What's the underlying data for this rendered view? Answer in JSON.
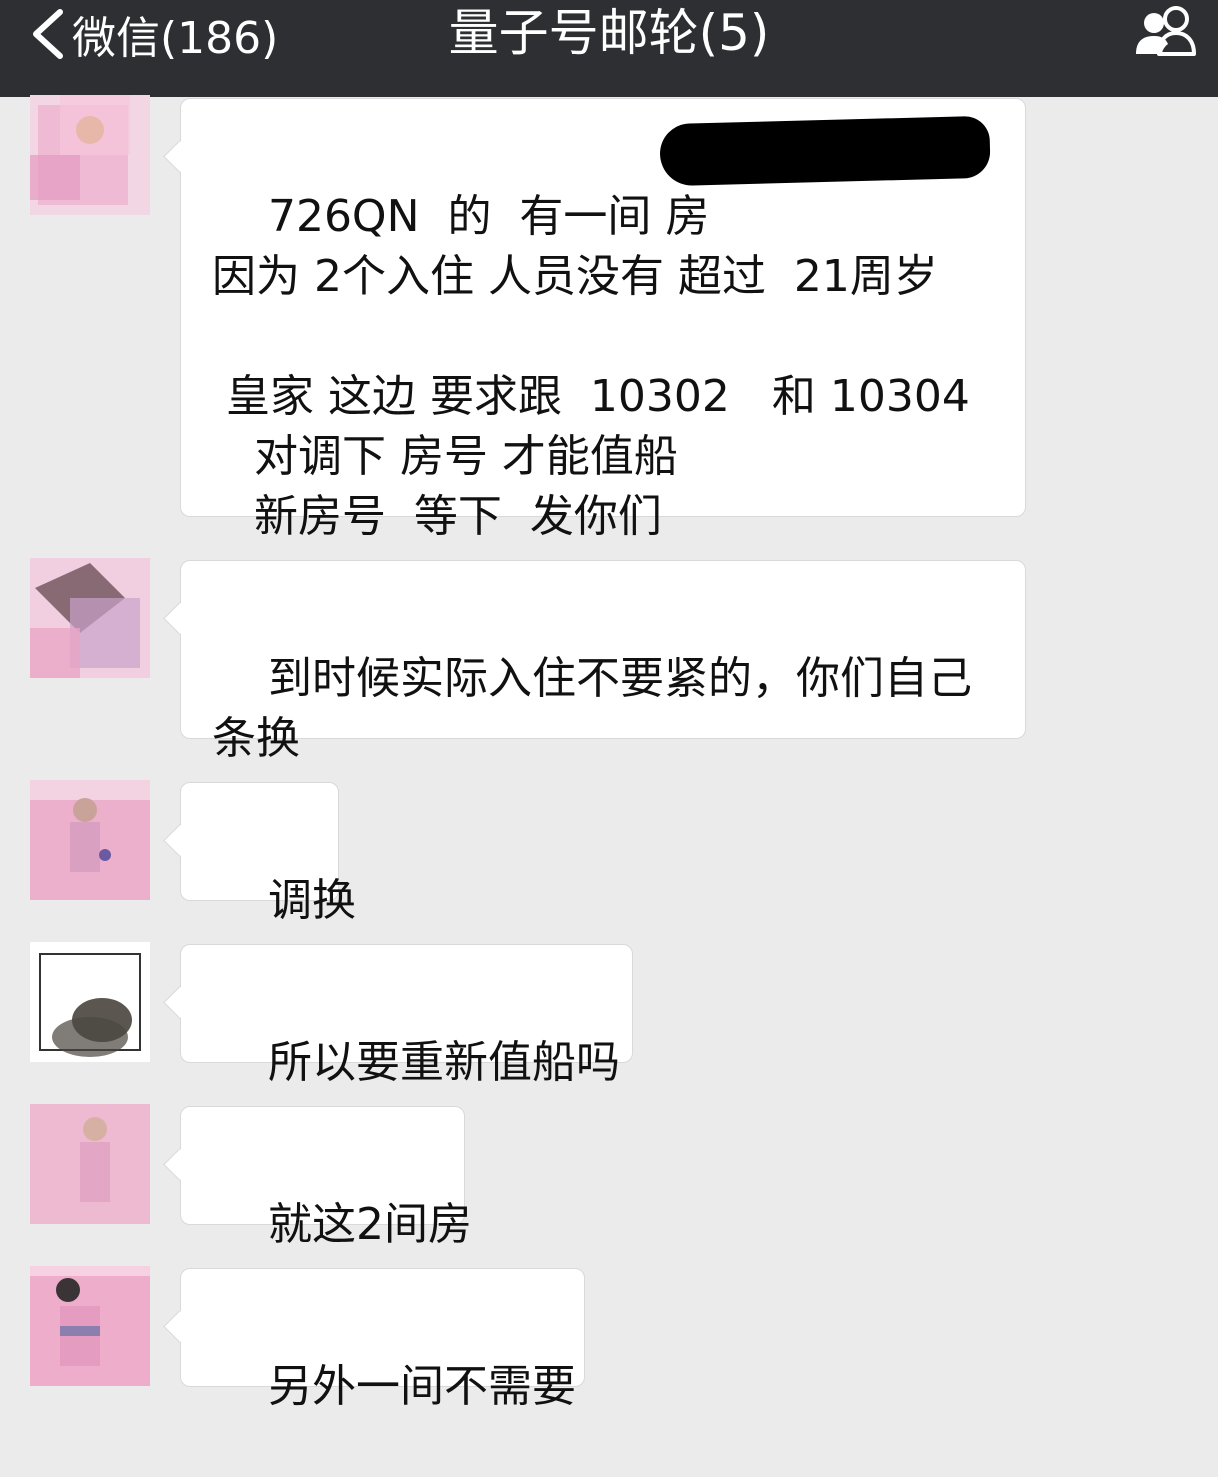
{
  "navbar": {
    "back_label": "微信(186)",
    "title": "量子号邮轮(5)",
    "back_icon": "chevron-left-icon",
    "group_icon": "group-members-icon",
    "background": "#2e2f33"
  },
  "chat": {
    "background": "#ebebeb",
    "messages": [
      {
        "text": "726QN  的  有一间 房\n因为 2个入住 人员没有 超过  21周岁\n\n 皇家 这边 要求跟  10302   和 10304\n   对调下 房号 才能值船\n   新房号  等下  发你们",
        "redacted": true
      },
      {
        "text": "到时候实际入住不要紧的，你们自己\n条换"
      },
      {
        "text": "调换"
      },
      {
        "text": "所以要重新值船吗"
      },
      {
        "text": "就这2间房"
      },
      {
        "text": "另外一间不需要"
      }
    ]
  }
}
